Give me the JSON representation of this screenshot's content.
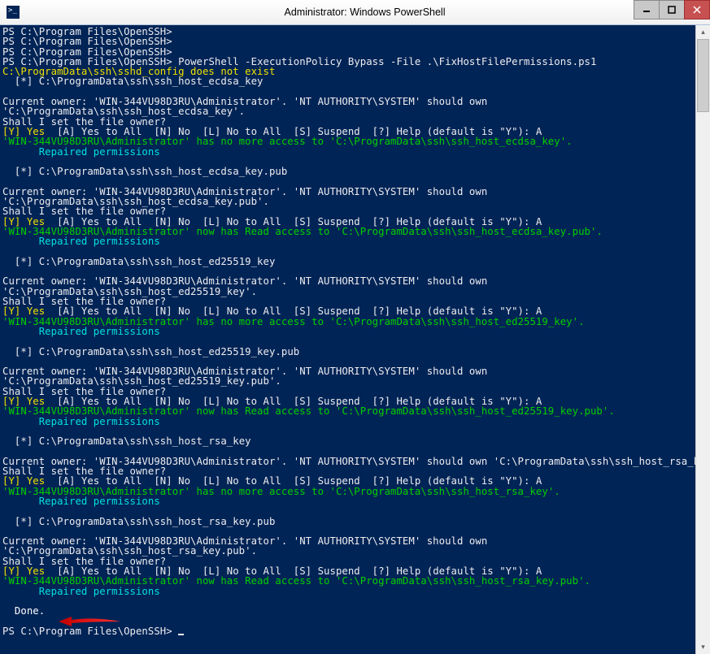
{
  "window": {
    "title": "Administrator: Windows PowerShell",
    "controls": {
      "min": "▁",
      "max": "▭",
      "close": "✕"
    }
  },
  "prompt": "PS C:\\Program Files\\OpenSSH>",
  "cmd": "PowerShell -ExecutionPolicy Bypass -File .\\FixHostFilePermissions.ps1",
  "err_sshd": "C:\\ProgramData\\ssh\\sshd_config does not exist",
  "indent_star": "  [*] ",
  "owner_prefix": "Current owner: 'WIN-344VU98D3RU\\Administrator'. 'NT AUTHORITY\\SYSTEM' should own ",
  "owner_line_A": "Current owner: 'WIN-344VU98D3RU\\Administrator'. 'NT AUTHORITY\\SYSTEM' should own",
  "owner_rsa_full": "Current owner: 'WIN-344VU98D3RU\\Administrator'. 'NT AUTHORITY\\SYSTEM' should own 'C:\\ProgramData\\ssh\\ssh_host_rsa_key'.",
  "shall_set": "Shall I set the file owner?",
  "choices": {
    "y_yes": "[Y] Yes",
    "rest": "  [A] Yes to All  [N] No  [L] No to All  [S] Suspend  [?] Help (default is \"Y\"): A"
  },
  "no_more_prefix": "'WIN-344VU98D3RU\\Administrator' has no more access to '",
  "read_access_prefix": "'WIN-344VU98D3RU\\Administrator' now has Read access to '",
  "suffix": "'.",
  "repaired": "      Repaired permissions",
  "paths": {
    "ecdsa": "C:\\ProgramData\\ssh\\ssh_host_ecdsa_key",
    "ecdsa_pub": "C:\\ProgramData\\ssh\\ssh_host_ecdsa_key.pub",
    "ed25519": "C:\\ProgramData\\ssh\\ssh_host_ed25519_key",
    "ed25519_pub": "C:\\ProgramData\\ssh\\ssh_host_ed25519_key.pub",
    "rsa": "C:\\ProgramData\\ssh\\ssh_host_rsa_key",
    "rsa_pub": "C:\\ProgramData\\ssh\\ssh_host_rsa_key.pub"
  },
  "owner_wrap": {
    "ecdsa": "'C:\\ProgramData\\ssh\\ssh_host_ecdsa_key'.",
    "ecdsa_pub": "'C:\\ProgramData\\ssh\\ssh_host_ecdsa_key.pub'.",
    "ed25519": "'C:\\ProgramData\\ssh\\ssh_host_ed25519_key'.",
    "ed25519_pub": "'C:\\ProgramData\\ssh\\ssh_host_ed25519_key.pub'.",
    "rsa_pub": "'C:\\ProgramData\\ssh\\ssh_host_rsa_key.pub'."
  },
  "done": "  Done.",
  "final_prompt": "PS C:\\Program Files\\OpenSSH> "
}
